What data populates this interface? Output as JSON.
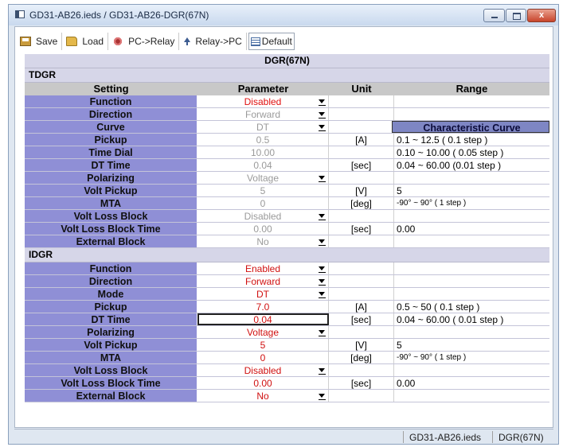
{
  "window": {
    "title": "GD31-AB26.ieds / GD31-AB26-DGR(67N)",
    "close_glyph": "x"
  },
  "toolbar": {
    "save": "Save",
    "load": "Load",
    "pc_to_relay": "PC->Relay",
    "relay_to_pc": "Relay->PC",
    "default": "Default"
  },
  "grid": {
    "title": "DGR(67N)",
    "columns": {
      "setting": "Setting",
      "parameter": "Parameter",
      "unit": "Unit",
      "range": "Range"
    },
    "characteristic_button": "Characteristic Curve"
  },
  "tdgr": {
    "label": "TDGR",
    "rows": [
      {
        "setting": "Function",
        "value": "Disabled",
        "unit": "",
        "range": ""
      },
      {
        "setting": "Direction",
        "value": "Forward",
        "unit": "",
        "range": ""
      },
      {
        "setting": "Curve",
        "value": "DT",
        "unit": "",
        "range": ""
      },
      {
        "setting": "Pickup",
        "value": "0.5",
        "unit": "[A]",
        "range": "0.1 ~ 12.5 ( 0.1 step )"
      },
      {
        "setting": "Time Dial",
        "value": "10.00",
        "unit": "",
        "range": "0.10 ~ 10.00 ( 0.05 step )"
      },
      {
        "setting": "DT Time",
        "value": "0.04",
        "unit": "[sec]",
        "range": "0.04 ~ 60.00 (0.01 step )"
      },
      {
        "setting": "Polarizing",
        "value": "Voltage",
        "unit": "",
        "range": ""
      },
      {
        "setting": "Volt Pickup",
        "value": "5",
        "unit": "[V]",
        "range": "5"
      },
      {
        "setting": "MTA",
        "value": "0",
        "unit": "[deg]",
        "range": "-90° ~ 90° ( 1 step )"
      },
      {
        "setting": "Volt Loss Block",
        "value": "Disabled",
        "unit": "",
        "range": ""
      },
      {
        "setting": "Volt Loss Block Time",
        "value": "0.00",
        "unit": "[sec]",
        "range": "0.00"
      },
      {
        "setting": "External Block",
        "value": "No",
        "unit": "",
        "range": ""
      }
    ]
  },
  "idgr": {
    "label": "IDGR",
    "rows": [
      {
        "setting": "Function",
        "value": "Enabled",
        "unit": "",
        "range": ""
      },
      {
        "setting": "Direction",
        "value": "Forward",
        "unit": "",
        "range": ""
      },
      {
        "setting": "Mode",
        "value": "DT",
        "unit": "",
        "range": ""
      },
      {
        "setting": "Pickup",
        "value": "7.0",
        "unit": "[A]",
        "range": "0.5 ~ 50 ( 0.1 step )"
      },
      {
        "setting": "DT Time",
        "value": "0.04",
        "unit": "[sec]",
        "range": "0.04 ~ 60.00 ( 0.01 step )"
      },
      {
        "setting": "Polarizing",
        "value": "Voltage",
        "unit": "",
        "range": ""
      },
      {
        "setting": "Volt Pickup",
        "value": "5",
        "unit": "[V]",
        "range": "5"
      },
      {
        "setting": "MTA",
        "value": "0",
        "unit": "[deg]",
        "range": "-90° ~ 90° ( 1 step )"
      },
      {
        "setting": "Volt Loss Block",
        "value": "Disabled",
        "unit": "",
        "range": ""
      },
      {
        "setting": "Volt Loss Block Time",
        "value": "0.00",
        "unit": "[sec]",
        "range": "0.00"
      },
      {
        "setting": "External Block",
        "value": "No",
        "unit": "",
        "range": ""
      }
    ]
  },
  "status": {
    "file": "GD31-AB26.ieds",
    "module": "DGR(67N)"
  },
  "colors": {
    "setting_cell": "#8f8fd6",
    "section_band": "#d6d6e8",
    "active_value": "#e01010",
    "disabled_value": "#9a9a9a"
  }
}
